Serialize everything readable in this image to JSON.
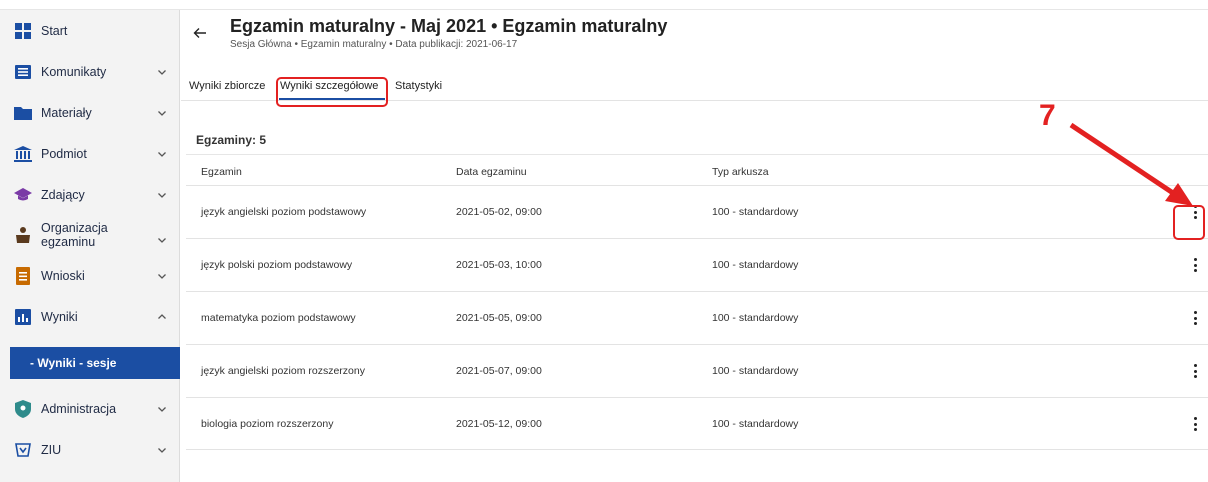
{
  "sidebar": {
    "items": [
      {
        "label": "Start",
        "icon": "grid-icon",
        "chevron": false
      },
      {
        "label": "Komunikaty",
        "icon": "message-icon",
        "chevron": "down"
      },
      {
        "label": "Materiały",
        "icon": "folder-icon",
        "chevron": "down"
      },
      {
        "label": "Podmiot",
        "icon": "institution-icon",
        "chevron": "down"
      },
      {
        "label": "Zdający",
        "icon": "graduation-cap-icon",
        "chevron": "down"
      },
      {
        "label": "Organizacja egzaminu",
        "icon": "desk-icon",
        "chevron": "down"
      },
      {
        "label": "Wnioski",
        "icon": "document-icon",
        "chevron": "down"
      },
      {
        "label": "Wyniki",
        "icon": "bar-chart-icon",
        "chevron": "up"
      },
      {
        "label": "Administracja",
        "icon": "shield-icon",
        "chevron": "down"
      },
      {
        "label": "ZIU",
        "icon": "ziu-icon",
        "chevron": "down"
      }
    ],
    "active_subitem": "- Wyniki - sesje"
  },
  "header": {
    "title": "Egzamin maturalny - Maj 2021 • Egzamin maturalny",
    "subtitle": "Sesja Główna • Egzamin maturalny • Data publikacji: 2021-06-17"
  },
  "tabs": [
    "Wyniki zbiorcze",
    "Wyniki szczegółowe",
    "Statystyki"
  ],
  "active_tab": "Wyniki szczegółowe",
  "exam_count_label": "Egzaminy: 5",
  "table": {
    "columns": [
      "Egzamin",
      "Data egzaminu",
      "Typ arkusza"
    ],
    "rows": [
      {
        "exam": "język angielski poziom podstawowy",
        "date": "2021-05-02, 09:00",
        "type": "100 - standardowy"
      },
      {
        "exam": "język polski poziom podstawowy",
        "date": "2021-05-03, 10:00",
        "type": "100 - standardowy"
      },
      {
        "exam": "matematyka poziom podstawowy",
        "date": "2021-05-05, 09:00",
        "type": "100 - standardowy"
      },
      {
        "exam": "język angielski poziom rozszerzony",
        "date": "2021-05-07, 09:00",
        "type": "100 - standardowy"
      },
      {
        "exam": "biologia poziom rozszerzony",
        "date": "2021-05-12, 09:00",
        "type": "100 - standardowy"
      }
    ]
  },
  "annotation": {
    "number": "7",
    "color": "#e32121"
  },
  "colors": {
    "accent": "#1b4ea3",
    "highlight": "#e32121",
    "sidebar_bg": "#f3f3f3"
  }
}
